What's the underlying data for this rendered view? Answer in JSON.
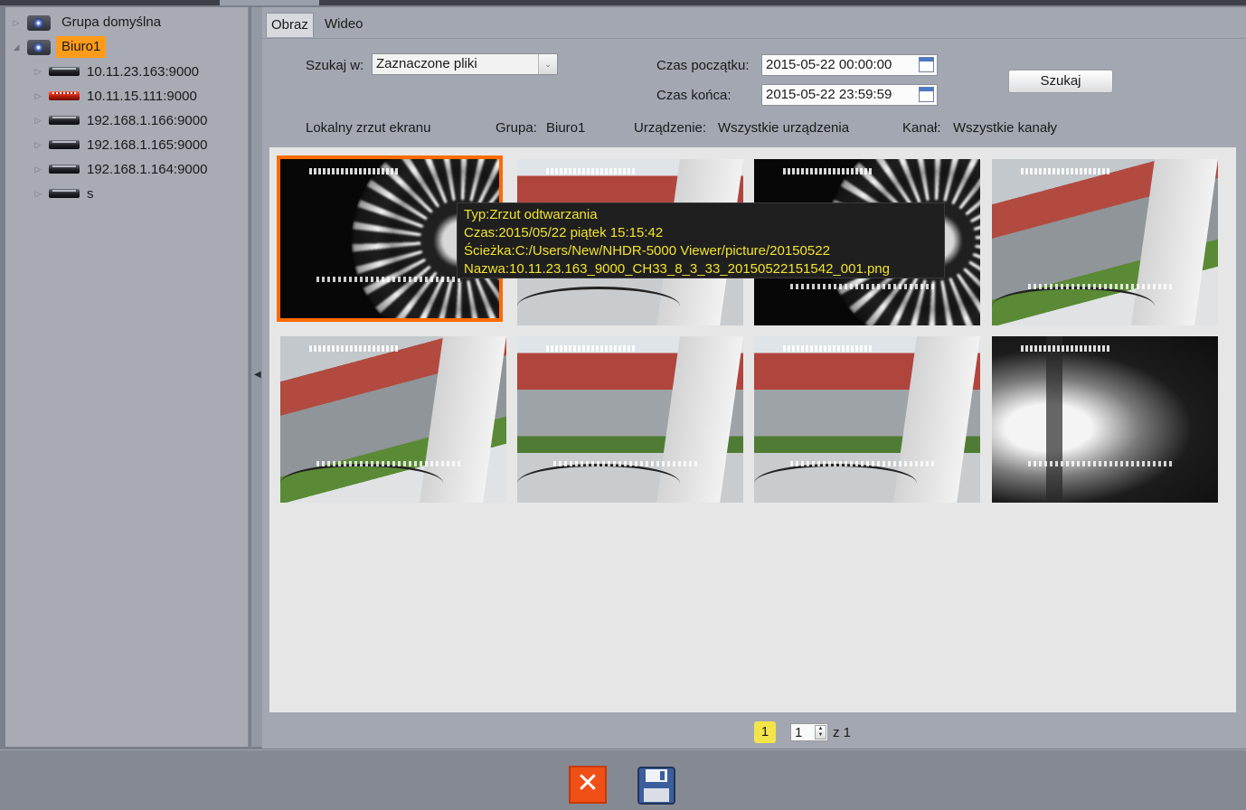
{
  "tree": {
    "groups": [
      {
        "label": "Grupa domyślna",
        "expanded": false,
        "selected": false
      },
      {
        "label": "Biuro1",
        "expanded": true,
        "selected": true
      }
    ],
    "devices": [
      {
        "label": "10.11.23.163:9000",
        "icon": "dvr-icon"
      },
      {
        "label": "10.11.15.111:9000",
        "icon": "dvr-red-icon"
      },
      {
        "label": "192.168.1.166:9000",
        "icon": "dvr-icon"
      },
      {
        "label": "192.168.1.165:9000",
        "icon": "dvr-icon"
      },
      {
        "label": "192.168.1.164:9000",
        "icon": "dvr-icon"
      },
      {
        "label": "s",
        "icon": "dvr-icon"
      }
    ]
  },
  "tabs": [
    {
      "label": "Obraz",
      "active": true
    },
    {
      "label": "Wideo",
      "active": false
    }
  ],
  "search": {
    "search_in_label": "Szukaj w:",
    "search_in_value": "Zaznaczone pliki",
    "start_label": "Czas początku:",
    "start_value": "2015-05-22 00:00:00",
    "end_label": "Czas końca:",
    "end_value": "2015-05-22 23:59:59",
    "button_label": "Szukaj"
  },
  "info": {
    "type": "Lokalny zrzut ekranu",
    "group_label": "Grupa:",
    "group_value": "Biuro1",
    "device_label": "Urządzenie:",
    "device_value": "Wszystkie urządzenia",
    "channel_label": "Kanał:",
    "channel_value": "Wszystkie kanały"
  },
  "thumbnails": [
    {
      "kind": "night",
      "selected": true
    },
    {
      "kind": "street",
      "selected": false
    },
    {
      "kind": "night",
      "selected": false
    },
    {
      "kind": "street",
      "selected": false
    },
    {
      "kind": "street",
      "selected": false
    },
    {
      "kind": "street",
      "selected": false
    },
    {
      "kind": "street",
      "selected": false
    },
    {
      "kind": "dark",
      "selected": false
    }
  ],
  "tooltip": {
    "type": "Typ:Zrzut odtwarzania",
    "time": "Czas:2015/05/22 piątek 15:15:42",
    "path": "Ścieżka:C:/Users/New/NHDR-5000 Viewer/picture/20150522",
    "name": "Nazwa:10.11.23.163_9000_CH33_8_3_33_20150522151542_001.png"
  },
  "pager": {
    "current": "1",
    "input": "1",
    "of_text": "z 1"
  },
  "footer": {
    "close_icon": "close-icon",
    "save_icon": "save-icon",
    "close_color": "#f04f16"
  },
  "colors": {
    "selection": "#ff9b1b",
    "thumb_border": "#ff6a00",
    "tooltip_text": "#f2e32b",
    "pager_highlight": "#f3e44a"
  }
}
